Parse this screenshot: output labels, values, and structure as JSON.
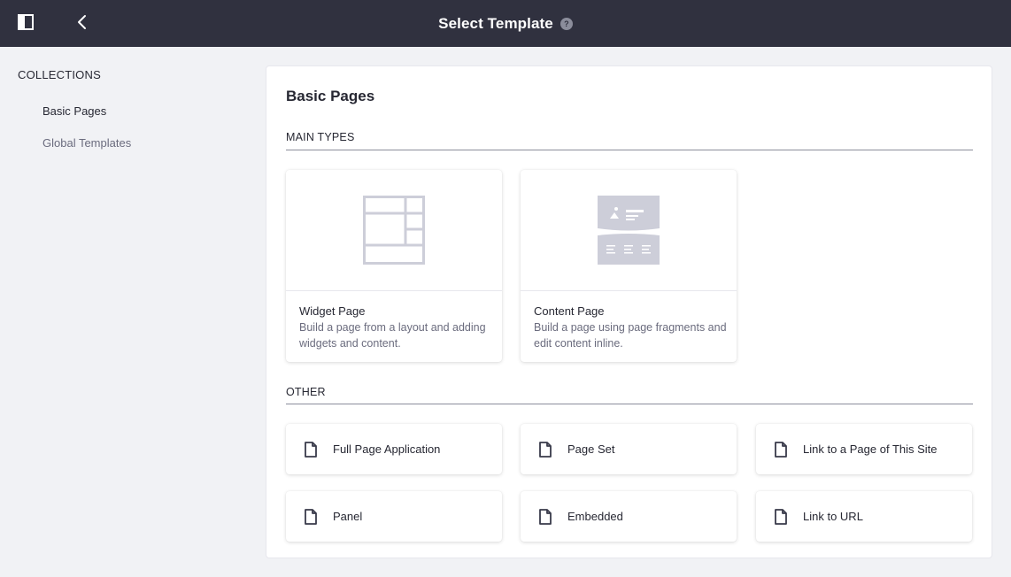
{
  "header": {
    "title": "Select Template",
    "help_glyph": "?"
  },
  "sidebar": {
    "heading": "COLLECTIONS",
    "items": [
      {
        "label": "Basic Pages",
        "active": true
      },
      {
        "label": "Global Templates",
        "active": false
      }
    ]
  },
  "main": {
    "title": "Basic Pages",
    "main_types_label": "MAIN TYPES",
    "other_label": "OTHER",
    "main_types": [
      {
        "title": "Widget Page",
        "description": "Build a page from a layout and adding widgets and content.",
        "icon": "widget-page-preview-icon"
      },
      {
        "title": "Content Page",
        "description": "Build a page using page fragments and edit content inline.",
        "icon": "content-page-preview-icon"
      }
    ],
    "other_types": [
      {
        "label": "Full Page Application",
        "icon": "document-icon"
      },
      {
        "label": "Page Set",
        "icon": "document-icon"
      },
      {
        "label": "Link to a Page of This Site",
        "icon": "document-icon"
      },
      {
        "label": "Panel",
        "icon": "document-icon"
      },
      {
        "label": "Embedded",
        "icon": "document-icon"
      },
      {
        "label": "Link to URL",
        "icon": "document-icon"
      }
    ]
  },
  "colors": {
    "header_bg": "#30313f",
    "page_bg": "#f1f2f5",
    "preview_gray": "#cdced9",
    "muted_text": "#6b6c7e"
  }
}
